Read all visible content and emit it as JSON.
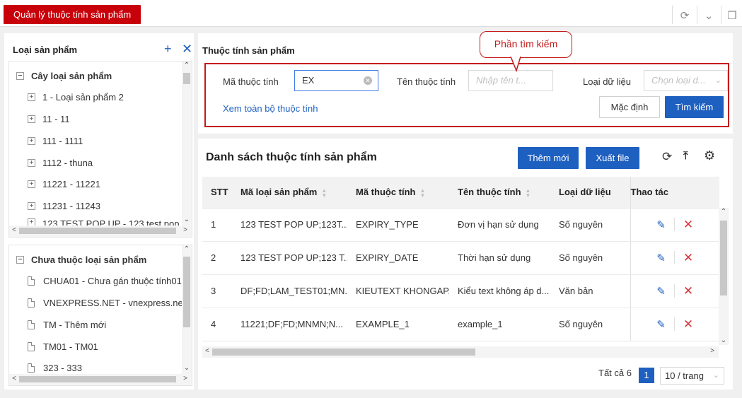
{
  "page_tab": "Quản lý thuộc tính sản phẩm",
  "top_icons": [
    "refresh-icon",
    "chevron-down-icon",
    "fullscreen-icon"
  ],
  "left_panel": {
    "title": "Loại sản phẩm",
    "tree_root": "Cây loại sản phẩm",
    "tree_items": [
      "1 - Loại sản phẩm 2",
      "11 - 11",
      "111 - 1111",
      "1112 - thuna",
      "11221 - 11221",
      "11231 - 11243",
      "123 TEST POP UP - 123 test pop"
    ],
    "unassigned_root": "Chưa thuộc loại sản phẩm",
    "unassigned_items": [
      "CHUA01 - Chưa gán thuộc tính01",
      "VNEXPRESS.NET - vnexpress.net",
      "TM - Thêm mới",
      "TM01 - TM01",
      "323 - 333"
    ]
  },
  "search": {
    "section_title": "Thuộc tính sản phẩm",
    "callout": "Phần tìm kiếm",
    "code_label": "Mã thuộc tính",
    "code_value": "EX",
    "name_label": "Tên thuộc tính",
    "name_placeholder": "Nhập tên t...",
    "type_label": "Loại dữ liệu",
    "type_placeholder": "Chọn loại d...",
    "view_all_link": "Xem toàn bộ thuộc tính",
    "default_button": "Mặc định",
    "search_button": "Tìm kiếm"
  },
  "list": {
    "title": "Danh sách thuộc tính sản phẩm",
    "add_button": "Thêm mới",
    "export_button": "Xuất file",
    "columns": [
      "STT",
      "Mã loại sản phẩm",
      "Mã thuộc tính",
      "Tên thuộc tính",
      "Loại dữ liệu",
      "Thao tác"
    ],
    "rows": [
      {
        "stt": "1",
        "category_code": "123 TEST POP UP;123T...",
        "attr_code": "EXPIRY_TYPE",
        "attr_name": "Đơn vị hạn sử dụng",
        "data_type": "Số nguyên"
      },
      {
        "stt": "2",
        "category_code": "123 TEST POP UP;123 T...",
        "attr_code": "EXPIRY_DATE",
        "attr_name": "Thời hạn sử dụng",
        "data_type": "Số nguyên"
      },
      {
        "stt": "3",
        "category_code": "DF;FD;LAM_TEST01;MN...",
        "attr_code": "KIEUTEXT KHONGAP...",
        "attr_name": "Kiểu text không áp d...",
        "data_type": "Văn bản"
      },
      {
        "stt": "4",
        "category_code": "11221;DF;FD;MNMN;N...",
        "attr_code": "EXAMPLE_1",
        "attr_name": "example_1",
        "data_type": "Số nguyên"
      }
    ],
    "total": "Tất cả 6",
    "current_page": "1",
    "page_size": "10 / trang"
  }
}
